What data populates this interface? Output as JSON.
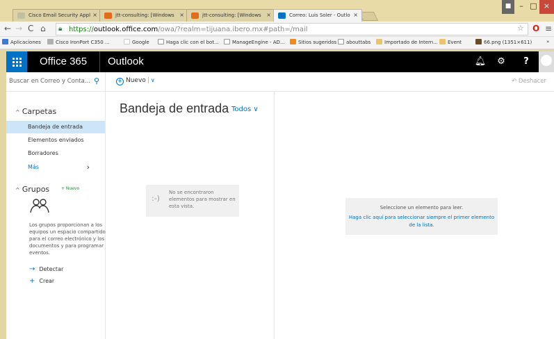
{
  "browser": {
    "tabs": [
      {
        "label": "Cisco Email Security Appl",
        "icon_color": "#c0c0a0"
      },
      {
        "label": "jtt-consulting: [Windows",
        "icon_color": "#e36b1c"
      },
      {
        "label": "jtt-consulting: [Windows",
        "icon_color": "#e36b1c"
      },
      {
        "label": "Correo: Luis Soler - Outlo",
        "icon_color": "#0072c6"
      }
    ],
    "tab_close": "×",
    "url_https": "https://",
    "url_host": "outlook.office.com",
    "url_rest": "/owa/?realm=tijuana.ibero.mx#path=/mail",
    "bookmarks": [
      {
        "label": "Aplicaciones",
        "icon_color": "#3a7bd5"
      },
      {
        "label": "Cisco IronPort C350 ...",
        "icon_color": "#b0b0b0"
      },
      {
        "label": "Google",
        "icon_color": "#ffffff"
      },
      {
        "label": "Haga clic con el bot...",
        "icon_color": "#ffffff"
      },
      {
        "label": "ManageEngine - AD...",
        "icon_color": "#ffffff"
      },
      {
        "label": "Sitios sugeridos",
        "icon_color": "#f28a1b"
      },
      {
        "label": "abouttabs",
        "icon_color": "#ffffff"
      },
      {
        "label": "Importado de Intern...",
        "icon_color": "#e9c46a"
      },
      {
        "label": "Event",
        "icon_color": "#e9c46a"
      },
      {
        "label": "66.png (1351×611)",
        "icon_color": "#6a4b2a"
      }
    ],
    "bookmarks_more": "»",
    "win_minimize": "–",
    "win_maximize": "□",
    "win_close": "×"
  },
  "suite": {
    "app_name": "Office 365",
    "module": "Outlook",
    "accent": "#0072c6"
  },
  "command": {
    "search_placeholder": "Buscar en Correo y Conta...",
    "new_label": "Nuevo",
    "undo_label": "Deshacer"
  },
  "nav": {
    "folders_header": "Carpetas",
    "folders": [
      {
        "label": "Bandeja de entrada",
        "selected": true
      },
      {
        "label": "Elementos enviados",
        "selected": false
      },
      {
        "label": "Borradores",
        "selected": false
      }
    ],
    "more_label": "Más",
    "groups_header": "Grupos",
    "groups_new": "+ Nuevo",
    "groups_description": "Los grupos proporcionan a los equipos un espacio compartido para el correo electrónico y los documentos y para programar eventos.",
    "discover_label": "Detectar",
    "create_label": "Crear"
  },
  "list": {
    "title": "Bandeja de entrada",
    "filter_label": "Todos",
    "empty_face": ":-)",
    "empty_message": "No se encontraron elementos para mostrar en esta vista."
  },
  "reading": {
    "line1": "Seleccione un elemento para leer.",
    "line2": "Haga clic aquí para seleccionar siempre el primer elemento de la lista."
  }
}
